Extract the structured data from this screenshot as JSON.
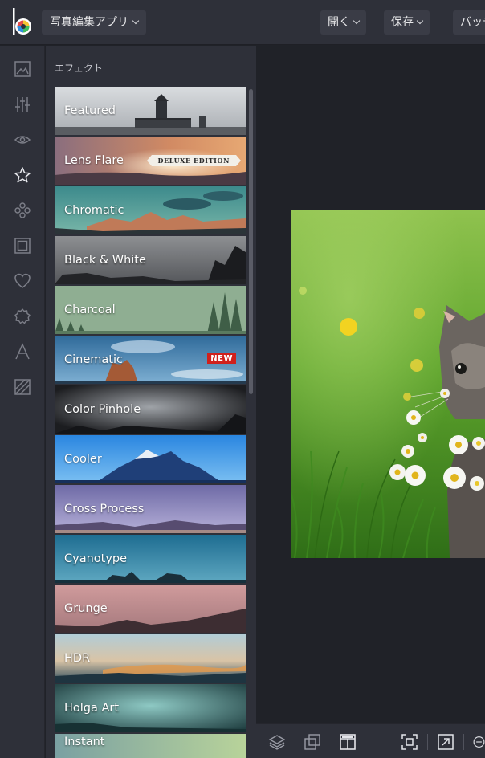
{
  "topbar": {
    "app_menu_label": "写真編集アプリ",
    "open_label": "開く",
    "save_label": "保存",
    "batch_label": "バッチ"
  },
  "rail": {
    "icons": [
      "image-icon",
      "sliders-icon",
      "eye-icon",
      "star-icon",
      "circles-icon",
      "frame-icon",
      "heart-icon",
      "badge-icon",
      "text-icon",
      "texture-icon"
    ],
    "active": "star-icon"
  },
  "panel": {
    "title": "エフェクト",
    "effects": [
      {
        "label": "Featured"
      },
      {
        "label": "Lens Flare",
        "badge": "DELUXE EDITION"
      },
      {
        "label": "Chromatic"
      },
      {
        "label": "Black & White"
      },
      {
        "label": "Charcoal"
      },
      {
        "label": "Cinematic",
        "badge": "NEW"
      },
      {
        "label": "Color Pinhole"
      },
      {
        "label": "Cooler"
      },
      {
        "label": "Cross Process"
      },
      {
        "label": "Cyanotype"
      },
      {
        "label": "Grunge"
      },
      {
        "label": "HDR"
      },
      {
        "label": "Holga Art"
      },
      {
        "label": "Instant"
      }
    ]
  },
  "bottombar": {
    "icons": [
      "layers-icon",
      "compare-icon",
      "layout-icon",
      "fit-screen-icon",
      "actual-size-icon",
      "zoom-out-icon"
    ]
  },
  "colors": {
    "bg_dark": "#202228",
    "panel": "#2e3039",
    "accent_new": "#d0201c"
  }
}
